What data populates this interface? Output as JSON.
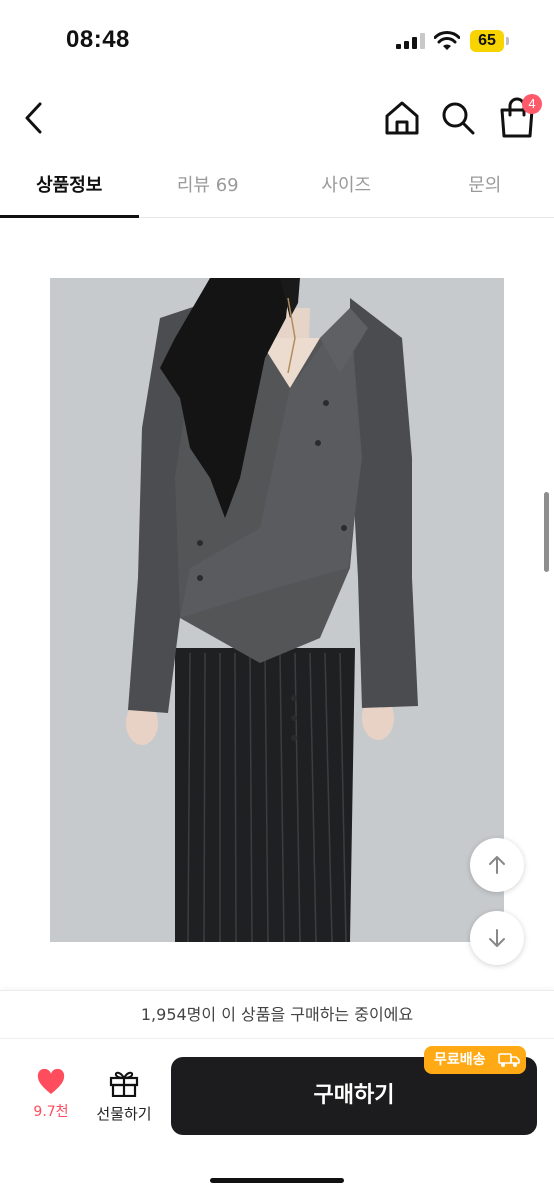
{
  "status_bar": {
    "time": "08:48",
    "battery": "65"
  },
  "nav": {
    "cart_count": "4"
  },
  "tabs": [
    {
      "label": "상품정보",
      "active": true
    },
    {
      "label": "리뷰 69",
      "active": false
    },
    {
      "label": "사이즈",
      "active": false
    },
    {
      "label": "문의",
      "active": false
    }
  ],
  "notice": {
    "text": "1,954명이 이 상품을 구매하는 중이에요"
  },
  "actions": {
    "like_count": "9.7천",
    "gift_label": "선물하기",
    "buy_label": "구매하기",
    "free_shipping": "무료배송"
  },
  "colors": {
    "accent_red": "#ff4d5e",
    "badge_red": "#ff5a6a",
    "buy_button": "#1c1c1e",
    "free_shipping": "#ffaa14",
    "battery": "#f7d300"
  },
  "icons": {
    "back": "chevron-left-icon",
    "home": "home-icon",
    "search": "search-icon",
    "cart": "shopping-bag-icon",
    "scroll_up": "arrow-up-icon",
    "scroll_down": "arrow-down-icon",
    "like": "heart-icon",
    "gift": "gift-icon",
    "free_shipping": "truck-icon"
  }
}
